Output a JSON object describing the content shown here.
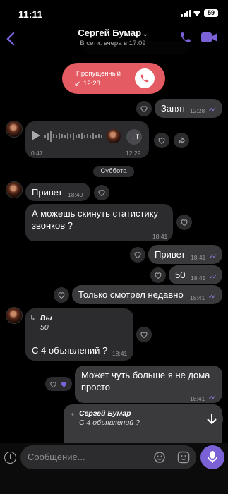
{
  "status_bar": {
    "time": "11:11",
    "battery": "59"
  },
  "header": {
    "contact_name": "Сергей Бумар",
    "subtitle": "В сети: вчера в 17:09"
  },
  "missed_call": {
    "label": "Пропущенный",
    "time": "12:28"
  },
  "messages": {
    "m1": {
      "text": "Занят",
      "time": "12:28"
    },
    "voice": {
      "duration": "0:47",
      "time": "12:29",
      "transcribe": "→T"
    },
    "day_separator": "Суббота",
    "m2": {
      "text": "Привет",
      "time": "18:40"
    },
    "m3": {
      "text_line1": "А можешь скинуть статистику",
      "text_line2": "звонков ?",
      "time": "18:41"
    },
    "m4": {
      "text": "Привет",
      "time": "18:41"
    },
    "m5": {
      "text": "50",
      "time": "18:41"
    },
    "m6": {
      "text": "Только смотрел недавно",
      "time": "18:41"
    },
    "m7": {
      "quote_author": "Вы",
      "quote_text": "50",
      "text": "С 4 объявлений ?",
      "time": "18:41"
    },
    "m8": {
      "text_line1": "Может чуть больше я не дома",
      "text_line2": "просто",
      "time": "18:41"
    },
    "m9": {
      "quote_author": "Сергей Бумар",
      "quote_text": "С 4 объявлений ?"
    }
  },
  "composer": {
    "placeholder": "Сообщение..."
  },
  "colors": {
    "accent": "#7b61d6",
    "missed": "#e45b63",
    "bubble": "#2c2c2e",
    "ticks": "#8e84e8"
  }
}
